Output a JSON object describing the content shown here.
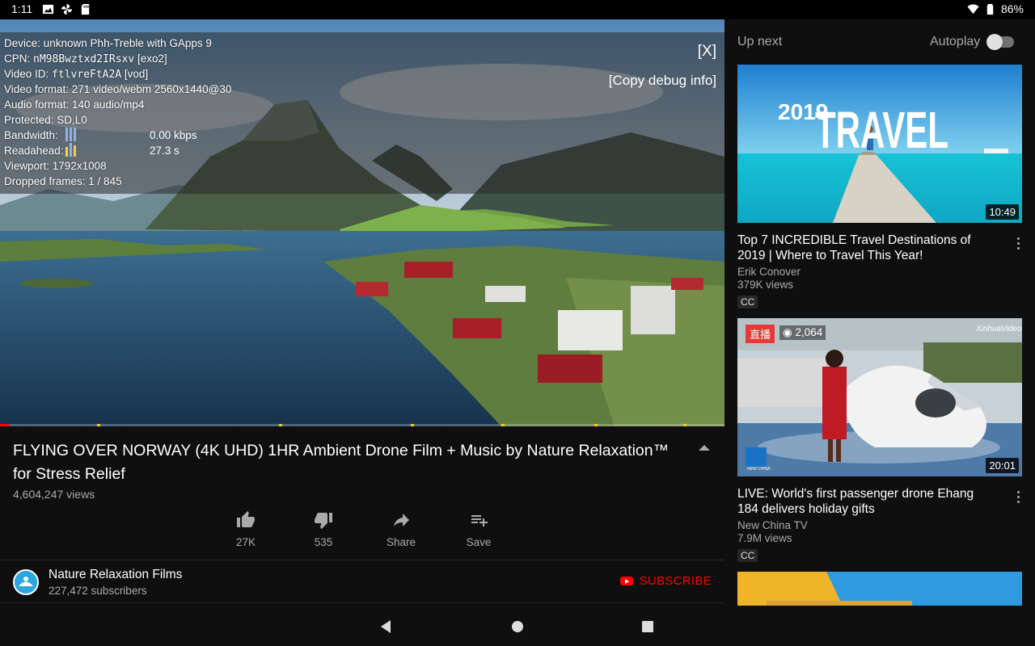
{
  "status_bar": {
    "time": "1:11",
    "battery": "86%"
  },
  "player": {
    "debug": {
      "device": "Device: unknown Phh-Treble with GApps 9",
      "cpn_label": "CPN: ",
      "cpn_value": "nM98Bwztxd2IRsxv",
      "cpn_suffix": " [exo2]",
      "video_id_label": "Video ID: ",
      "video_id_value": "ftlvreFtA2A",
      "video_id_suffix": " [vod]",
      "video_format": "Video format: 271 video/webm 2560x1440@30",
      "audio_format": "Audio format: 140 audio/mp4",
      "protected": "Protected: SD,L0",
      "bandwidth_label": "Bandwidth:",
      "bandwidth_value": "0.00 kbps",
      "readahead_label": "Readahead:",
      "readahead_value": "27.3 s",
      "viewport": "Viewport: 1792x1008",
      "dropped_frames": "Dropped frames: 1 / 845",
      "close_label": "[X]",
      "copy_label": "[Copy debug info]"
    },
    "progress_fraction": 0.012
  },
  "video": {
    "title": "FLYING OVER NORWAY (4K UHD) 1HR Ambient Drone Film + Music by Nature Relaxation™ for Stress Relief",
    "views": "4,604,247 views"
  },
  "actions": [
    {
      "label": "27K",
      "icon": "thumbs-up-icon"
    },
    {
      "label": "535",
      "icon": "thumbs-down-icon"
    },
    {
      "label": "Share",
      "icon": "share-icon"
    },
    {
      "label": "Save",
      "icon": "playlist-add-icon"
    }
  ],
  "channel": {
    "name": "Nature Relaxation Films",
    "subscribers": "227,472 subscribers",
    "subscribe_label": "SUBSCRIBE"
  },
  "sidebar": {
    "up_next": "Up next",
    "autoplay": "Autoplay",
    "autoplay_on": false,
    "items": [
      {
        "thumb_text_year": "2019",
        "thumb_text_word": "TRAVEL",
        "duration": "10:49",
        "title": "Top 7 INCREDIBLE Travel Destinations of 2019 | Where to Travel This Year!",
        "channel": "Erik Conover",
        "views": "379K views",
        "badge": "CC"
      },
      {
        "live_badge": "直播",
        "live_viewers": "2,064",
        "thumb_watermark": "XinhuaVideo",
        "thumb_logo_text": "NEW CHINA",
        "duration": "20:01",
        "title": "LIVE: World's first passenger drone Ehang 184 delivers holiday gifts",
        "channel": "New China TV",
        "views": "7.9M views",
        "badge": "CC"
      }
    ]
  },
  "colors": {
    "accent": "#ff0000",
    "background": "#0f0f0f",
    "secondary_text": "#aaaaaa"
  }
}
